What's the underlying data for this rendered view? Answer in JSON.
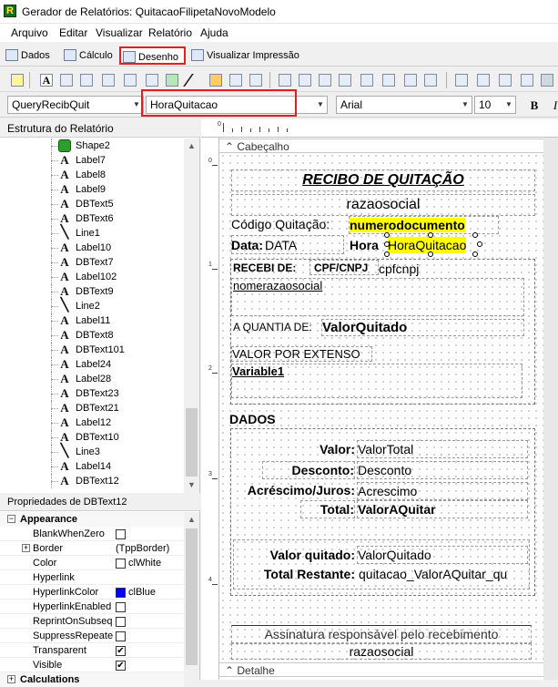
{
  "window": {
    "title": "Gerador de Relatórios: QuitacaoFilipetaNovoModelo",
    "app_icon_letter": "R"
  },
  "menu": [
    "Arquivo",
    "Editar",
    "Visualizar",
    "Relatório",
    "Ajuda"
  ],
  "tabs": [
    {
      "label": "Dados",
      "selected": false
    },
    {
      "label": "Cálculo",
      "selected": false
    },
    {
      "label": "Desenho",
      "selected": true
    },
    {
      "label": "Visualizar Impressão",
      "selected": false
    }
  ],
  "format_toolbar": {
    "datapipeline": "QueryRecibQuit",
    "field": "HoraQuitacao",
    "font": "Arial",
    "size": "10",
    "bold_label": "B",
    "italic_label": "I"
  },
  "tree": {
    "header": "Estrutura do Relatório",
    "items": [
      {
        "label": "Shape2",
        "icon": "shape-icon"
      },
      {
        "label": "Label7",
        "icon": "label-icon"
      },
      {
        "label": "Label8",
        "icon": "label-icon"
      },
      {
        "label": "Label9",
        "icon": "label-icon"
      },
      {
        "label": "DBText5",
        "icon": "dbtext-icon"
      },
      {
        "label": "DBText6",
        "icon": "dbtext-icon"
      },
      {
        "label": "Line1",
        "icon": "line-icon"
      },
      {
        "label": "Label10",
        "icon": "label-icon"
      },
      {
        "label": "DBText7",
        "icon": "dbtext-icon"
      },
      {
        "label": "Label102",
        "icon": "label-icon"
      },
      {
        "label": "DBText9",
        "icon": "dbtext-icon"
      },
      {
        "label": "Line2",
        "icon": "line-icon"
      },
      {
        "label": "Label11",
        "icon": "label-icon"
      },
      {
        "label": "DBText8",
        "icon": "dbtext-icon"
      },
      {
        "label": "DBText101",
        "icon": "dbtext-icon"
      },
      {
        "label": "Label24",
        "icon": "label-icon"
      },
      {
        "label": "Label28",
        "icon": "label-icon"
      },
      {
        "label": "DBText23",
        "icon": "dbtext-icon"
      },
      {
        "label": "DBText21",
        "icon": "dbtext-icon"
      },
      {
        "label": "Label12",
        "icon": "label-icon"
      },
      {
        "label": "DBText10",
        "icon": "dbtext-icon"
      },
      {
        "label": "Line3",
        "icon": "line-icon"
      },
      {
        "label": "Label14",
        "icon": "label-icon"
      },
      {
        "label": "DBText12",
        "icon": "dbtext-icon"
      }
    ]
  },
  "properties": {
    "header": "Propriedades de DBText12",
    "category": "Appearance",
    "rows": [
      {
        "name": "BlankWhenZero",
        "type": "check",
        "value": false
      },
      {
        "name": "Border",
        "type": "text",
        "value": "(TppBorder)",
        "expandable": true
      },
      {
        "name": "Color",
        "type": "color",
        "value": "clWhite",
        "swatch": "#ffffff"
      },
      {
        "name": "Hyperlink",
        "type": "text",
        "value": ""
      },
      {
        "name": "HyperlinkColor",
        "type": "color",
        "value": "clBlue",
        "swatch": "#0000ff"
      },
      {
        "name": "HyperlinkEnabled",
        "type": "check",
        "value": false
      },
      {
        "name": "ReprintOnSubsequent",
        "type": "check",
        "value": false
      },
      {
        "name": "SuppressRepeatedValues",
        "type": "check",
        "value": false
      },
      {
        "name": "Transparent",
        "type": "check",
        "value": true
      },
      {
        "name": "Visible",
        "type": "check",
        "value": true
      }
    ],
    "next_category": "Calculations"
  },
  "bands": {
    "header": "Cabeçalho",
    "detail": "Detalhe"
  },
  "report": {
    "title": "RECIBO DE QUITAÇÃO",
    "razao_top": "razaosocial",
    "codigo_label": "Código Quitação:",
    "codigo_value": "numerodocumento",
    "data_label": "Data:",
    "data_value": "DATA",
    "hora_label": "Hora",
    "hora_value": "HoraQuitacao",
    "recebi_label": "RECEBI DE:",
    "cpf_label": "CPF/CNPJ",
    "cpf_value": "cpfcnpj",
    "nome_value": "nomerazaosocial",
    "quantia_label": "A QUANTIA DE:",
    "quantia_value": "ValorQuitado",
    "extenso_label": "VALOR POR EXTENSO",
    "extenso_value": "Variable1",
    "dados_label": "DADOS",
    "valor_label": "Valor:",
    "valor_value": "ValorTotal",
    "desconto_label": "Desconto:",
    "desconto_value": "Desconto",
    "acrescimo_label": "Acréscimo/Juros:",
    "acrescimo_value": "Acrescimo",
    "total_label": "Total:",
    "total_value": "ValorAQuitar",
    "quitado_label": "Valor quitado:",
    "quitado_value": "ValorQuitado",
    "restante_label": "Total Restante:",
    "restante_value": "quitacao_ValorAQuitar_qu",
    "assinatura_label": "Assinatura responsável pelo recebimento",
    "razao_bottom": "razaosocial"
  },
  "ruler": {
    "h": [
      "0"
    ],
    "v": [
      "0",
      "1",
      "2",
      "3",
      "4"
    ]
  },
  "colors": {
    "highlight": "#ffff00",
    "selection_box": "#e02020"
  }
}
